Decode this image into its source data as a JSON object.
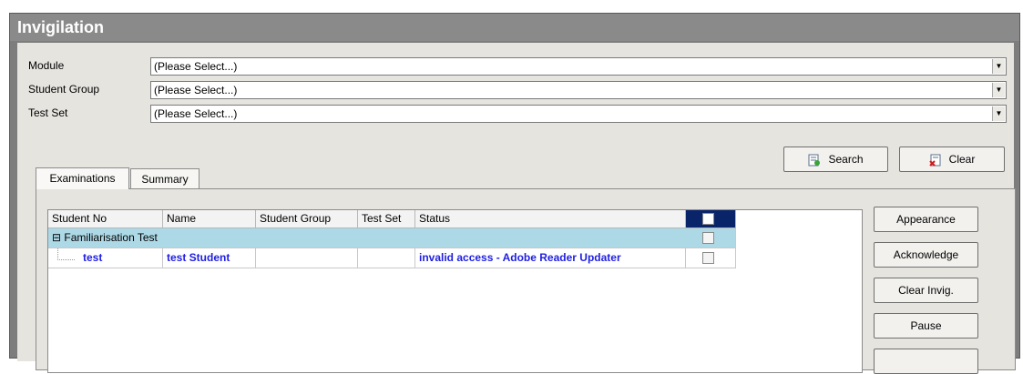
{
  "window": {
    "title": "Invigilation"
  },
  "filters": [
    {
      "label": "Module",
      "value": "(Please Select...)"
    },
    {
      "label": "Student Group",
      "value": "(Please Select...)"
    },
    {
      "label": "Test Set",
      "value": "(Please Select...)"
    }
  ],
  "toolbar": {
    "search_label": "Search",
    "clear_label": "Clear"
  },
  "tabs": [
    {
      "label": "Examinations",
      "active": true
    },
    {
      "label": "Summary",
      "active": false
    }
  ],
  "grid": {
    "columns": [
      "Student No",
      "Name",
      "Student Group",
      "Test Set",
      "Status"
    ],
    "group": {
      "expander": "⊟",
      "label": "Familiarisation Test"
    },
    "rows": [
      {
        "student_no": "test",
        "name": "test Student",
        "student_group": "",
        "test_set": "",
        "status": "invalid access - Adobe Reader Updater"
      }
    ]
  },
  "side_buttons": {
    "appearance": "Appearance",
    "acknowledge": "Acknowledge",
    "clear_invig": "Clear Invig.",
    "pause": "Pause"
  },
  "colors": {
    "title_bg": "#8a8a8a",
    "panel_bg": "#e6e4df",
    "group_row_bg": "#add8e6",
    "header_check_bg": "#0a246a",
    "link_text": "#1f1fe0"
  }
}
